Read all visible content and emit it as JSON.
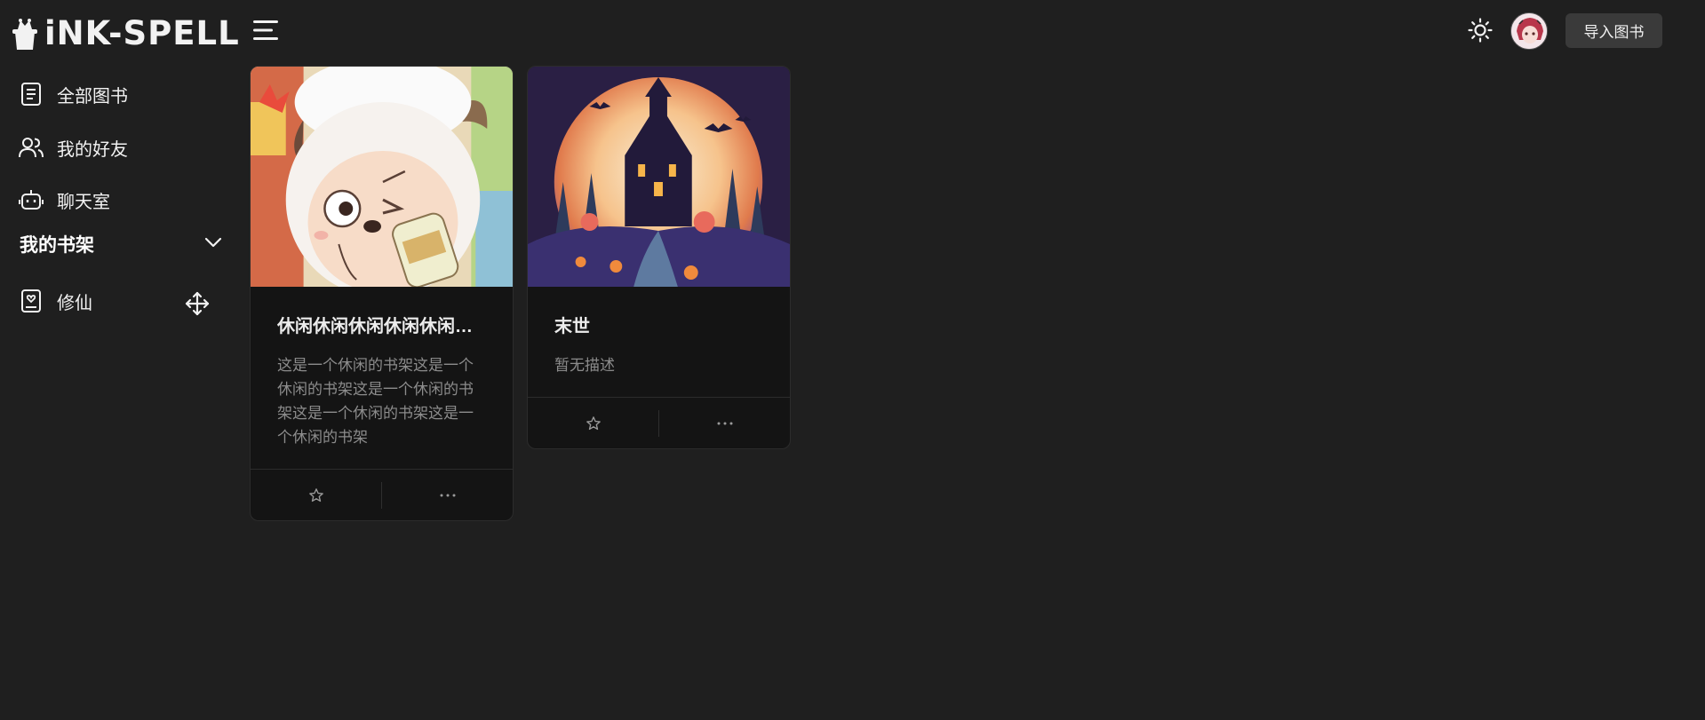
{
  "header": {
    "logo_text": "iNK-SPELL",
    "import_button_label": "导入图书"
  },
  "sidebar": {
    "items": [
      {
        "label": "全部图书",
        "icon": "book-icon"
      },
      {
        "label": "我的好友",
        "icon": "users-icon"
      },
      {
        "label": "聊天室",
        "icon": "robot-icon"
      }
    ],
    "section": {
      "title": "我的书架",
      "icon": "chevron-down-icon"
    },
    "shelves": [
      {
        "label": "修仙",
        "icon": "bookmark-heart-icon"
      }
    ]
  },
  "books": [
    {
      "title": "休闲休闲休闲休闲休闲休闲休闲",
      "description": "这是一个休闲的书架这是一个休闲的书架这是一个休闲的书架这是一个休闲的书架这是一个休闲的书架",
      "cover": "cartoon-sheep-cover"
    },
    {
      "title": "末世",
      "description": "暂无描述",
      "cover": "haunted-castle-cover"
    }
  ],
  "colors": {
    "background": "#1f1f1f",
    "card_background": "#141414",
    "button_background": "#3a3a3a",
    "text_primary": "#f2f2f2",
    "text_secondary": "#8c8c8c"
  }
}
